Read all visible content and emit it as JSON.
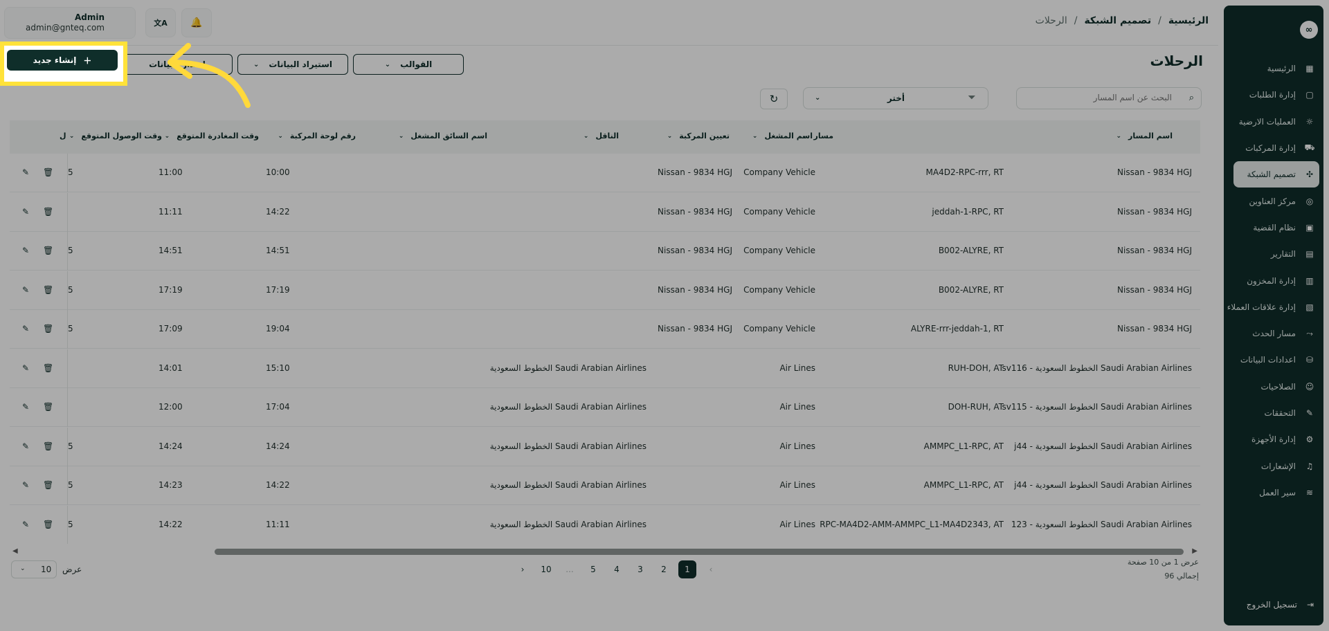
{
  "sidebar": {
    "logo": "∞",
    "items": [
      {
        "label": "الرئيسية",
        "icon": "dashboard-icon",
        "glyph": "▦"
      },
      {
        "label": "إدارة الطلبات",
        "icon": "orders-icon",
        "glyph": "▢"
      },
      {
        "label": "العمليات الارضية",
        "icon": "ground-ops-icon",
        "glyph": "☼"
      },
      {
        "label": "إدارة المركبات",
        "icon": "truck-icon",
        "glyph": "⛟"
      },
      {
        "label": "تصميم الشبكة",
        "icon": "network-icon",
        "glyph": "✣",
        "active": true
      },
      {
        "label": "مركز العناوين",
        "icon": "location-icon",
        "glyph": "◎"
      },
      {
        "label": "نظام القضية",
        "icon": "case-icon",
        "glyph": "▣"
      },
      {
        "label": "التقارير",
        "icon": "reports-icon",
        "glyph": "▤"
      },
      {
        "label": "إدارة المخزون",
        "icon": "inventory-icon",
        "glyph": "▥"
      },
      {
        "label": "إدارة علاقات العملاء",
        "icon": "crm-icon",
        "glyph": "▧"
      },
      {
        "label": "مسار الحدث",
        "icon": "event-path-icon",
        "glyph": "⤳"
      },
      {
        "label": "اعدادات البيانات",
        "icon": "database-icon",
        "glyph": "⛁"
      },
      {
        "label": "الصلاحيات",
        "icon": "users-icon",
        "glyph": "☺"
      },
      {
        "label": "التحققات",
        "icon": "validation-icon",
        "glyph": "✎"
      },
      {
        "label": "إدارة الأجهزة",
        "icon": "devices-icon",
        "glyph": "⚙"
      },
      {
        "label": "الإشعارات",
        "icon": "bell-icon",
        "glyph": "♫"
      },
      {
        "label": "سير العمل",
        "icon": "workflow-icon",
        "glyph": "≋"
      }
    ],
    "logout": "تسجيل الخروج"
  },
  "header": {
    "breadcrumb": [
      "الرئيسية",
      "/",
      "تصميم الشبكة",
      "/",
      "الرحلات"
    ],
    "user_name": "Admin",
    "user_email": "admin@gnteq.com",
    "translate_glyph": "文A",
    "bell_glyph": "🔔"
  },
  "page": {
    "title": "الرحلات",
    "templates_label": "القوالب",
    "import_label": "استيراد البيانات",
    "export_label": "اصدار البيانات",
    "create_label": "إنشاء جديد"
  },
  "filters": {
    "search_placeholder": "البحث عن اسم المسار",
    "select_value": "أختر"
  },
  "table": {
    "columns": [
      "اسم المسار",
      "مسار",
      "اسم المشغل",
      "تعيين المركبة",
      "الناقل",
      "اسم السائق المشغل",
      "رقم لوحة المركبة",
      "وقت المغادرة المتوقع",
      "وقت الوصول المتوقع",
      "ل"
    ],
    "rows": [
      {
        "route_name": "Nissan - 9834 HGJ",
        "path": "MA4D2-RPC-rrr, RT",
        "operator": "Company Vehicle",
        "vehicle": "Nissan - 9834 HGJ",
        "carrier": "",
        "dep": "10:00",
        "arr": "11:00",
        "cut": "5"
      },
      {
        "route_name": "Nissan - 9834 HGJ",
        "path": "jeddah-1-RPC, RT",
        "operator": "Company Vehicle",
        "vehicle": "Nissan - 9834 HGJ",
        "carrier": "",
        "dep": "14:22",
        "arr": "11:11",
        "cut": ""
      },
      {
        "route_name": "Nissan - 9834 HGJ",
        "path": "B002-ALYRE, RT",
        "operator": "Company Vehicle",
        "vehicle": "Nissan - 9834 HGJ",
        "carrier": "",
        "dep": "14:51",
        "arr": "14:51",
        "cut": "5"
      },
      {
        "route_name": "Nissan - 9834 HGJ",
        "path": "B002-ALYRE, RT",
        "operator": "Company Vehicle",
        "vehicle": "Nissan - 9834 HGJ",
        "carrier": "",
        "dep": "17:19",
        "arr": "17:19",
        "cut": "5"
      },
      {
        "route_name": "Nissan - 9834 HGJ",
        "path": "ALYRE-rrr-jeddah-1, RT",
        "operator": "Company Vehicle",
        "vehicle": "Nissan - 9834 HGJ",
        "carrier": "",
        "dep": "19:04",
        "arr": "17:09",
        "cut": "5"
      },
      {
        "route_name": "sv116 - الخطوط السعودية Saudi Arabian Airlines",
        "path": "RUH-DOH, AT",
        "operator": "Air Lines",
        "vehicle": "",
        "carrier": "الخطوط السعودية Saudi Arabian Airlines",
        "dep": "15:10",
        "arr": "14:01",
        "cut": ""
      },
      {
        "route_name": "sv115 - الخطوط السعودية Saudi Arabian Airlines",
        "path": "DOH-RUH, AT",
        "operator": "Air Lines",
        "vehicle": "",
        "carrier": "الخطوط السعودية Saudi Arabian Airlines",
        "dep": "17:04",
        "arr": "12:00",
        "cut": ""
      },
      {
        "route_name": "j44 - الخطوط السعودية Saudi Arabian Airlines",
        "path": "AMMPC_L1-RPC, AT",
        "operator": "Air Lines",
        "vehicle": "",
        "carrier": "الخطوط السعودية Saudi Arabian Airlines",
        "dep": "14:24",
        "arr": "14:24",
        "cut": "5"
      },
      {
        "route_name": "j44 - الخطوط السعودية Saudi Arabian Airlines",
        "path": "AMMPC_L1-RPC, AT",
        "operator": "Air Lines",
        "vehicle": "",
        "carrier": "الخطوط السعودية Saudi Arabian Airlines",
        "dep": "14:22",
        "arr": "14:23",
        "cut": "5"
      },
      {
        "route_name": "123 - الخطوط السعودية Saudi Arabian Airlines",
        "path": "RPC-MA4D2-AMM-AMMPC_L1-MA4D2343, AT",
        "operator": "Air Lines",
        "vehicle": "",
        "carrier": "الخطوط السعودية Saudi Arabian Airlines",
        "dep": "11:11",
        "arr": "14:22",
        "cut": "5"
      }
    ]
  },
  "pagination": {
    "info": "عرض 1 من 10 صفحة",
    "total": "إجمالي 96",
    "prev": "‹",
    "next": "›",
    "pages": [
      "1",
      "2",
      "3",
      "4",
      "5",
      "...",
      "10"
    ],
    "per_page_label": "عرض",
    "per_page_value": "10"
  },
  "colors": {
    "primary": "#0f2e2a",
    "highlight": "#ffe23a"
  }
}
